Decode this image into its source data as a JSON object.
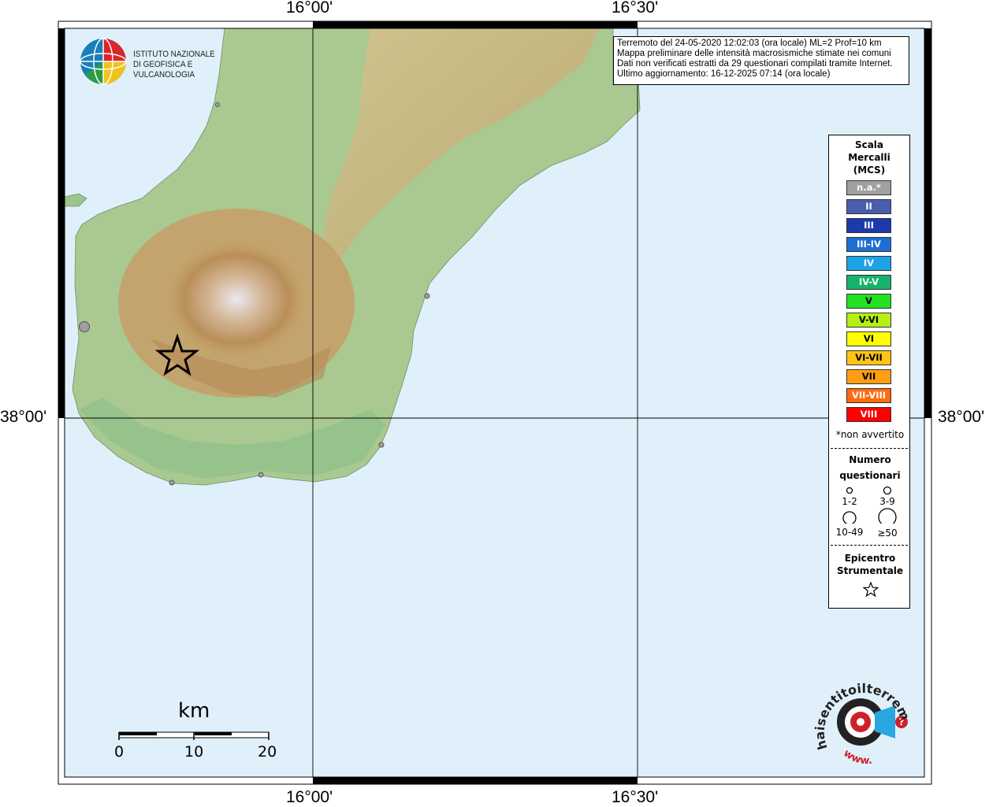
{
  "map": {
    "lon_ticks": [
      "16°00'",
      "16°30'"
    ],
    "lat_ticks": [
      "38°00'"
    ],
    "colors": {
      "sea": "#dff0fb",
      "land_low": "#8fc08a",
      "land_high": "#b4874f",
      "peak": "#e9e4ea"
    }
  },
  "logo": {
    "line1": "ISTITUTO NAZIONALE",
    "line2": "DI GEOFISICA E VULCANOLOGIA",
    "icon": "ingv-globe-icon"
  },
  "info": {
    "line1": "Terremoto del 24-05-2020 12:02:03 (ora locale) ML=2 Prof=10 km",
    "line2": "Mappa preliminare delle intensità macrosismiche stimate nei comuni",
    "line3": "Dati non verificati estratti da 29 questionari compilati tramite Internet.",
    "line4": "Ultimo aggiornamento: 16-12-2025 07:14 (ora locale)"
  },
  "legend": {
    "title_line1": "Scala",
    "title_line2": "Mercalli",
    "title_line3": "(MCS)",
    "scale": [
      {
        "label": "n.a.*",
        "color": "#a0a0a0"
      },
      {
        "label": "II",
        "color": "#4a5eae"
      },
      {
        "label": "III",
        "color": "#1c3aab"
      },
      {
        "label": "III-IV",
        "color": "#1d6fd3"
      },
      {
        "label": "IV",
        "color": "#1ba3e6"
      },
      {
        "label": "IV-V",
        "color": "#15b36a"
      },
      {
        "label": "V",
        "color": "#22e022"
      },
      {
        "label": "V-VI",
        "color": "#b6ef14"
      },
      {
        "label": "VI",
        "color": "#ffff00"
      },
      {
        "label": "VI-VII",
        "color": "#ffc414"
      },
      {
        "label": "VII",
        "color": "#ff9e14"
      },
      {
        "label": "VII-VIII",
        "color": "#ff6a0e"
      },
      {
        "label": "VIII",
        "color": "#ff0000"
      }
    ],
    "note": "*non avvertito",
    "numero_line1": "Numero",
    "numero_line2": "questionari",
    "sizes": [
      "1-2",
      "3-9",
      "10-49",
      "≥50"
    ],
    "epicentro_line1": "Epicentro",
    "epicentro_line2": "Strumentale",
    "epicentro_icon": "star-icon"
  },
  "scalebar": {
    "unit": "km",
    "labels": [
      "0",
      "10",
      "20"
    ]
  },
  "badge": {
    "text_top": "haisentitoilterremoto.it",
    "text_bottom": "www.",
    "question": "?",
    "icon": "earthquake-target-icon"
  }
}
